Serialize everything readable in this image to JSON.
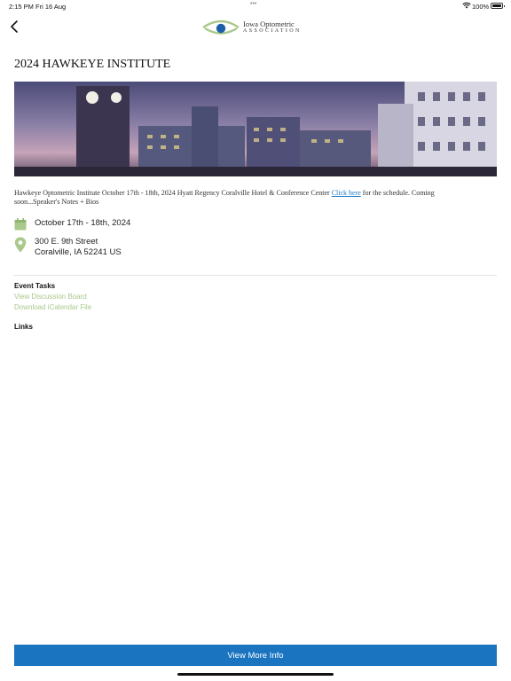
{
  "status_bar": {
    "time": "2:15 PM",
    "date": "Fri 16 Aug",
    "dots": "•••",
    "battery_percent": "100%",
    "battery_level": 1.0
  },
  "header": {
    "back_icon": "chevron-left-icon",
    "logo": {
      "line1": "Iowa Optometric",
      "line2": "ASSOCIATION"
    }
  },
  "event": {
    "title": "2024 HAWKEYE INSTITUTE",
    "description_before": "Hawkeye Optometric Institute October 17th - 18th, 2024 Hyatt Regency Coralville Hotel & Conference Center ",
    "description_link": "Click here",
    "description_after": " for the schedule. Coming soon...Speaker's Notes + Bios",
    "date": "October 17th - 18th, 2024",
    "address_line1": "300 E. 9th Street",
    "address_line2": "Coralville, IA 52241 US"
  },
  "tasks": {
    "label": "Event Tasks",
    "items": [
      "View Discussion Board",
      "Download iCalendar File"
    ]
  },
  "links": {
    "label": "Links"
  },
  "cta": {
    "label": "View More Info"
  },
  "colors": {
    "accent_green": "#a9c88a",
    "button_blue": "#1a74c0",
    "link_blue": "#1f7ac4"
  }
}
